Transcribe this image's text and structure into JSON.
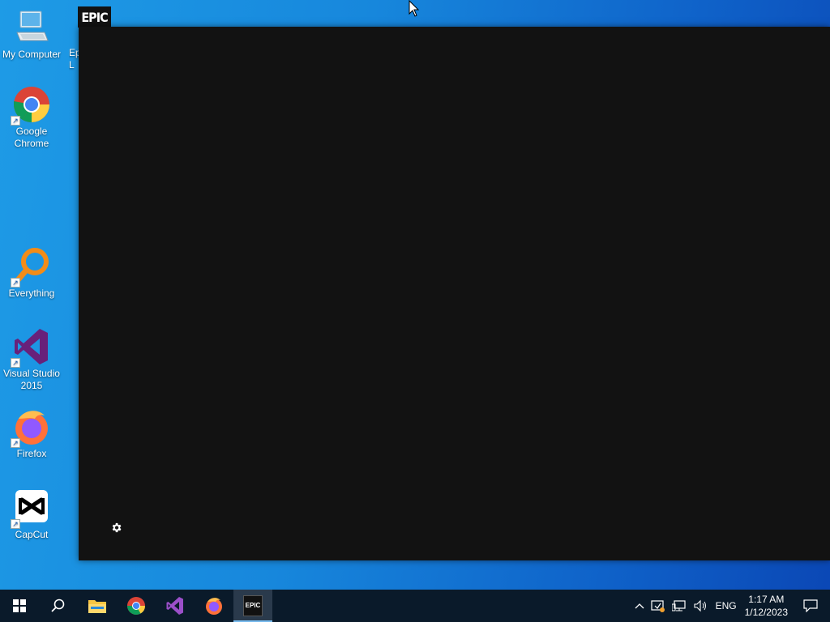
{
  "desktop": {
    "icons": [
      {
        "id": "my-computer",
        "label": "My Computer"
      },
      {
        "id": "google-chrome",
        "label": "Google\nChrome"
      },
      {
        "id": "everything",
        "label": "Everything"
      },
      {
        "id": "visual-studio",
        "label": "Visual Studio\n2015"
      },
      {
        "id": "firefox",
        "label": "Firefox"
      },
      {
        "id": "capcut",
        "label": "CapCut"
      }
    ],
    "partial_label": "Ep\nL"
  },
  "epic_window": {
    "badge": "EPIC"
  },
  "taskbar": {
    "apps": [
      "start",
      "search",
      "file-explorer",
      "chrome",
      "visual-studio",
      "firefox",
      "epic-games"
    ],
    "epic_badge": "EPIC",
    "language": "ENG",
    "time": "1:17 AM",
    "date": "1/12/2023"
  },
  "colors": {
    "desktop_gradient_start": "#1e9be6",
    "desktop_gradient_end": "#0b47b5",
    "window_bg": "#121212",
    "taskbar_bg": "#0a1a2a"
  }
}
